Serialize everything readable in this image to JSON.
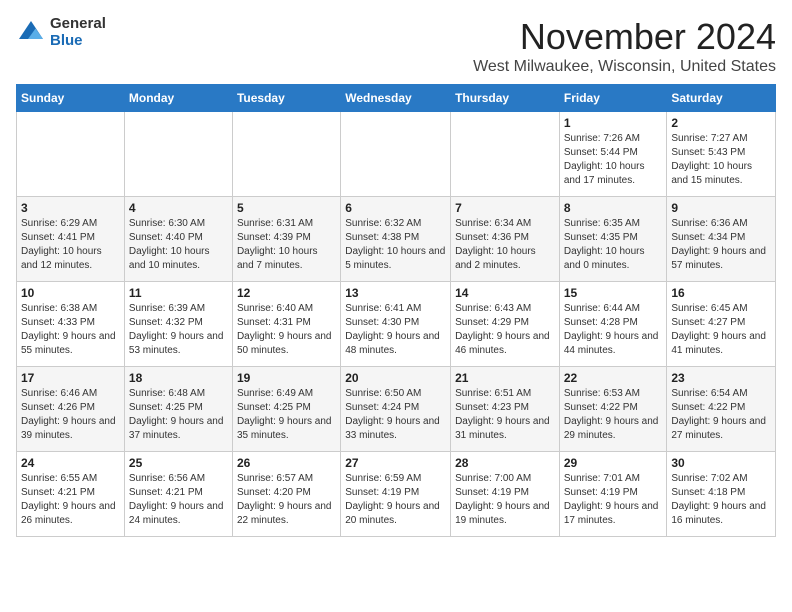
{
  "logo": {
    "general": "General",
    "blue": "Blue"
  },
  "header": {
    "month": "November 2024",
    "location": "West Milwaukee, Wisconsin, United States"
  },
  "weekdays": [
    "Sunday",
    "Monday",
    "Tuesday",
    "Wednesday",
    "Thursday",
    "Friday",
    "Saturday"
  ],
  "weeks": [
    [
      {
        "day": "",
        "info": ""
      },
      {
        "day": "",
        "info": ""
      },
      {
        "day": "",
        "info": ""
      },
      {
        "day": "",
        "info": ""
      },
      {
        "day": "",
        "info": ""
      },
      {
        "day": "1",
        "info": "Sunrise: 7:26 AM\nSunset: 5:44 PM\nDaylight: 10 hours and 17 minutes."
      },
      {
        "day": "2",
        "info": "Sunrise: 7:27 AM\nSunset: 5:43 PM\nDaylight: 10 hours and 15 minutes."
      }
    ],
    [
      {
        "day": "3",
        "info": "Sunrise: 6:29 AM\nSunset: 4:41 PM\nDaylight: 10 hours and 12 minutes."
      },
      {
        "day": "4",
        "info": "Sunrise: 6:30 AM\nSunset: 4:40 PM\nDaylight: 10 hours and 10 minutes."
      },
      {
        "day": "5",
        "info": "Sunrise: 6:31 AM\nSunset: 4:39 PM\nDaylight: 10 hours and 7 minutes."
      },
      {
        "day": "6",
        "info": "Sunrise: 6:32 AM\nSunset: 4:38 PM\nDaylight: 10 hours and 5 minutes."
      },
      {
        "day": "7",
        "info": "Sunrise: 6:34 AM\nSunset: 4:36 PM\nDaylight: 10 hours and 2 minutes."
      },
      {
        "day": "8",
        "info": "Sunrise: 6:35 AM\nSunset: 4:35 PM\nDaylight: 10 hours and 0 minutes."
      },
      {
        "day": "9",
        "info": "Sunrise: 6:36 AM\nSunset: 4:34 PM\nDaylight: 9 hours and 57 minutes."
      }
    ],
    [
      {
        "day": "10",
        "info": "Sunrise: 6:38 AM\nSunset: 4:33 PM\nDaylight: 9 hours and 55 minutes."
      },
      {
        "day": "11",
        "info": "Sunrise: 6:39 AM\nSunset: 4:32 PM\nDaylight: 9 hours and 53 minutes."
      },
      {
        "day": "12",
        "info": "Sunrise: 6:40 AM\nSunset: 4:31 PM\nDaylight: 9 hours and 50 minutes."
      },
      {
        "day": "13",
        "info": "Sunrise: 6:41 AM\nSunset: 4:30 PM\nDaylight: 9 hours and 48 minutes."
      },
      {
        "day": "14",
        "info": "Sunrise: 6:43 AM\nSunset: 4:29 PM\nDaylight: 9 hours and 46 minutes."
      },
      {
        "day": "15",
        "info": "Sunrise: 6:44 AM\nSunset: 4:28 PM\nDaylight: 9 hours and 44 minutes."
      },
      {
        "day": "16",
        "info": "Sunrise: 6:45 AM\nSunset: 4:27 PM\nDaylight: 9 hours and 41 minutes."
      }
    ],
    [
      {
        "day": "17",
        "info": "Sunrise: 6:46 AM\nSunset: 4:26 PM\nDaylight: 9 hours and 39 minutes."
      },
      {
        "day": "18",
        "info": "Sunrise: 6:48 AM\nSunset: 4:25 PM\nDaylight: 9 hours and 37 minutes."
      },
      {
        "day": "19",
        "info": "Sunrise: 6:49 AM\nSunset: 4:25 PM\nDaylight: 9 hours and 35 minutes."
      },
      {
        "day": "20",
        "info": "Sunrise: 6:50 AM\nSunset: 4:24 PM\nDaylight: 9 hours and 33 minutes."
      },
      {
        "day": "21",
        "info": "Sunrise: 6:51 AM\nSunset: 4:23 PM\nDaylight: 9 hours and 31 minutes."
      },
      {
        "day": "22",
        "info": "Sunrise: 6:53 AM\nSunset: 4:22 PM\nDaylight: 9 hours and 29 minutes."
      },
      {
        "day": "23",
        "info": "Sunrise: 6:54 AM\nSunset: 4:22 PM\nDaylight: 9 hours and 27 minutes."
      }
    ],
    [
      {
        "day": "24",
        "info": "Sunrise: 6:55 AM\nSunset: 4:21 PM\nDaylight: 9 hours and 26 minutes."
      },
      {
        "day": "25",
        "info": "Sunrise: 6:56 AM\nSunset: 4:21 PM\nDaylight: 9 hours and 24 minutes."
      },
      {
        "day": "26",
        "info": "Sunrise: 6:57 AM\nSunset: 4:20 PM\nDaylight: 9 hours and 22 minutes."
      },
      {
        "day": "27",
        "info": "Sunrise: 6:59 AM\nSunset: 4:19 PM\nDaylight: 9 hours and 20 minutes."
      },
      {
        "day": "28",
        "info": "Sunrise: 7:00 AM\nSunset: 4:19 PM\nDaylight: 9 hours and 19 minutes."
      },
      {
        "day": "29",
        "info": "Sunrise: 7:01 AM\nSunset: 4:19 PM\nDaylight: 9 hours and 17 minutes."
      },
      {
        "day": "30",
        "info": "Sunrise: 7:02 AM\nSunset: 4:18 PM\nDaylight: 9 hours and 16 minutes."
      }
    ]
  ]
}
